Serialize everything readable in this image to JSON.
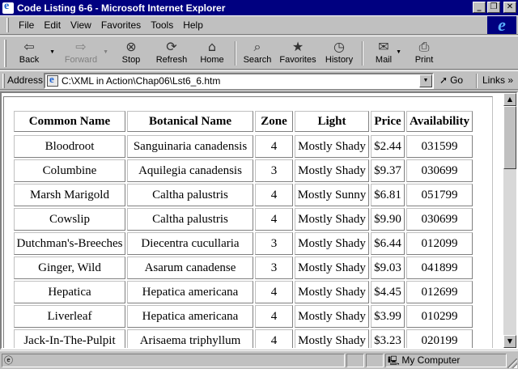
{
  "window": {
    "title": "Code Listing 6-6 - Microsoft Internet Explorer",
    "minimize_glyph": "_",
    "maximize_glyph": "❐",
    "close_glyph": "✕"
  },
  "menu": {
    "items": [
      "File",
      "Edit",
      "View",
      "Favorites",
      "Tools",
      "Help"
    ]
  },
  "toolbar": {
    "buttons": [
      {
        "label": "Back",
        "icon": "back-arrow-icon",
        "glyph": "⇦",
        "enabled": true
      },
      {
        "label": "Forward",
        "icon": "forward-arrow-icon",
        "glyph": "⇨",
        "enabled": false
      },
      {
        "label": "Stop",
        "icon": "stop-icon",
        "glyph": "⊗",
        "enabled": true
      },
      {
        "label": "Refresh",
        "icon": "refresh-icon",
        "glyph": "⟳",
        "enabled": true
      },
      {
        "label": "Home",
        "icon": "home-icon",
        "glyph": "⌂",
        "enabled": true
      },
      {
        "label": "Search",
        "icon": "search-icon",
        "glyph": "⌕",
        "enabled": true
      },
      {
        "label": "Favorites",
        "icon": "favorites-icon",
        "glyph": "★",
        "enabled": true
      },
      {
        "label": "History",
        "icon": "history-icon",
        "glyph": "◷",
        "enabled": true
      },
      {
        "label": "Mail",
        "icon": "mail-icon",
        "glyph": "✉",
        "enabled": true
      },
      {
        "label": "Print",
        "icon": "print-icon",
        "glyph": "⎙",
        "enabled": true
      }
    ]
  },
  "address": {
    "label": "Address",
    "url": "C:\\XML in Action\\Chap06\\Lst6_6.htm",
    "go_label": "Go",
    "links_label": "Links"
  },
  "table": {
    "headers": [
      "Common Name",
      "Botanical Name",
      "Zone",
      "Light",
      "Price",
      "Availability"
    ],
    "rows": [
      [
        "Bloodroot",
        "Sanguinaria canadensis",
        "4",
        "Mostly Shady",
        "$2.44",
        "031599"
      ],
      [
        "Columbine",
        "Aquilegia canadensis",
        "3",
        "Mostly Shady",
        "$9.37",
        "030699"
      ],
      [
        "Marsh Marigold",
        "Caltha palustris",
        "4",
        "Mostly Sunny",
        "$6.81",
        "051799"
      ],
      [
        "Cowslip",
        "Caltha palustris",
        "4",
        "Mostly Shady",
        "$9.90",
        "030699"
      ],
      [
        "Dutchman's-Breeches",
        "Diecentra cucullaria",
        "3",
        "Mostly Shady",
        "$6.44",
        "012099"
      ],
      [
        "Ginger, Wild",
        "Asarum canadense",
        "3",
        "Mostly Shady",
        "$9.03",
        "041899"
      ],
      [
        "Hepatica",
        "Hepatica americana",
        "4",
        "Mostly Shady",
        "$4.45",
        "012699"
      ],
      [
        "Liverleaf",
        "Hepatica americana",
        "4",
        "Mostly Shady",
        "$3.99",
        "010299"
      ],
      [
        "Jack-In-The-Pulpit",
        "Arisaema triphyllum",
        "4",
        "Mostly Shady",
        "$3.23",
        "020199"
      ]
    ]
  },
  "status": {
    "zone_label": "My Computer",
    "page_icon": "ie-page-icon",
    "zone_icon": "computer-icon"
  },
  "colors": {
    "title_bar": "#000080",
    "chrome": "#c0c0c0",
    "page_background": "#ffffff"
  }
}
